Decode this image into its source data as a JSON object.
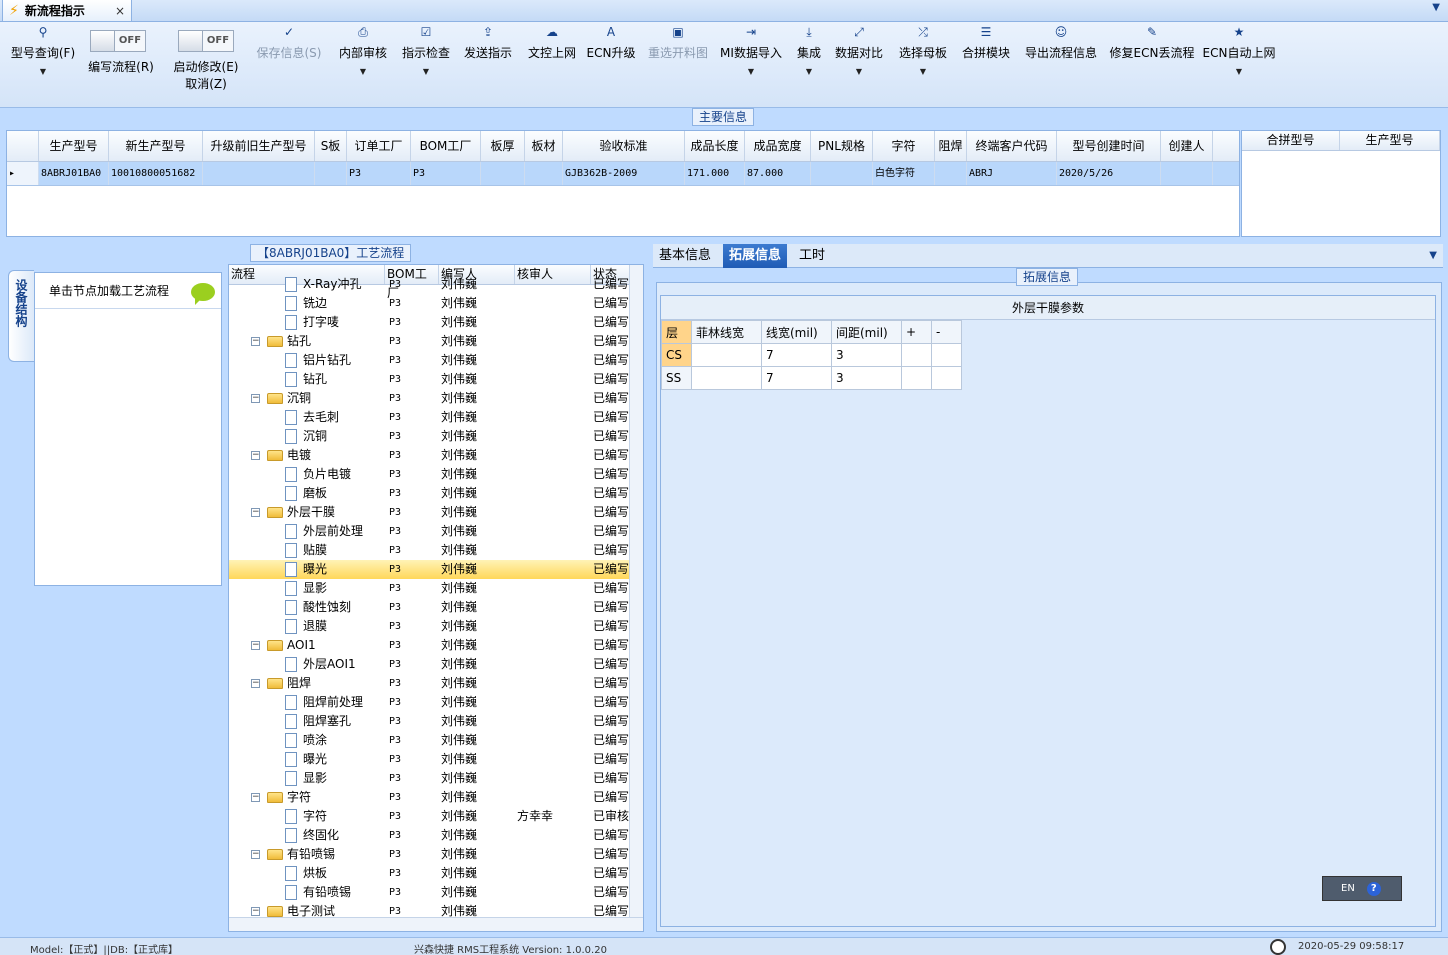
{
  "window": {
    "tab_title": "新流程指示",
    "close": "×",
    "menu_arrow": "▼"
  },
  "ribbon": {
    "buttons": [
      {
        "id": "query",
        "label": "型号查询(F)",
        "icon": "search-icon",
        "glyph": "⚲",
        "dropdown": true,
        "disabled": false
      },
      {
        "id": "save",
        "label": "保存信息(S)",
        "icon": "check-icon",
        "glyph": "✓",
        "dropdown": false,
        "disabled": true
      },
      {
        "id": "review",
        "label": "内部审核",
        "icon": "print-icon",
        "glyph": "⎙",
        "dropdown": true,
        "disabled": false
      },
      {
        "id": "check",
        "label": "指示检查",
        "icon": "checkbox-icon",
        "glyph": "☑",
        "dropdown": true,
        "disabled": false
      },
      {
        "id": "send",
        "label": "发送指示",
        "icon": "upload-icon",
        "glyph": "⇪",
        "dropdown": false,
        "disabled": false
      },
      {
        "id": "control",
        "label": "文控上网",
        "icon": "cloud-icon",
        "glyph": "☁",
        "dropdown": false,
        "disabled": false
      },
      {
        "id": "ecn",
        "label": "ECN升级",
        "icon": "tool-icon",
        "glyph": "A",
        "dropdown": false,
        "disabled": false
      },
      {
        "id": "reselect",
        "label": "重选开料图",
        "icon": "image-icon",
        "glyph": "▣",
        "dropdown": false,
        "disabled": true
      },
      {
        "id": "mi",
        "label": "MI数据导入",
        "icon": "import-icon",
        "glyph": "⇥",
        "dropdown": true,
        "disabled": false
      },
      {
        "id": "integrate",
        "label": "集成",
        "icon": "download-icon",
        "glyph": "⤓",
        "dropdown": true,
        "disabled": false
      },
      {
        "id": "compare",
        "label": "数据对比",
        "icon": "compare-icon",
        "glyph": "⤢",
        "dropdown": true,
        "disabled": false
      },
      {
        "id": "mother",
        "label": "选择母板",
        "icon": "shuffle-icon",
        "glyph": "⤮",
        "dropdown": true,
        "disabled": false
      },
      {
        "id": "merge",
        "label": "合拼模块",
        "icon": "list-icon",
        "glyph": "☰",
        "dropdown": false,
        "disabled": false
      },
      {
        "id": "export",
        "label": "导出流程信息",
        "icon": "smile-icon",
        "glyph": "☺",
        "dropdown": false,
        "disabled": false
      },
      {
        "id": "repair",
        "label": "修复ECN丢流程",
        "icon": "wrench-icon",
        "glyph": "✎",
        "dropdown": false,
        "disabled": false
      },
      {
        "id": "auto",
        "label": "ECN自动上网",
        "icon": "star-icon",
        "glyph": "★",
        "dropdown": true,
        "disabled": false
      }
    ],
    "toggle_edit": {
      "state": "OFF",
      "label": "编写流程(R)"
    },
    "toggle_start": {
      "state": "OFF",
      "label": "启动修改(E)",
      "sub_label": "取消(Z)"
    }
  },
  "main_info": {
    "caption": "主要信息",
    "columns": [
      "生产型号",
      "新生产型号",
      "升级前旧生产型号",
      "S板",
      "订单工厂",
      "BOM工厂",
      "板厚",
      "板材",
      "验收标准",
      "成品长度",
      "成品宽度",
      "PNL规格",
      "字符",
      "阻焊",
      "终端客户代码",
      "型号创建时间",
      "创建人"
    ],
    "row": [
      "8ABRJ01BA0",
      "10010800051682",
      "",
      "",
      "P3",
      "P3",
      "",
      "",
      "GJB362B-2009",
      "171.000",
      "87.000",
      "",
      "白色字符",
      "",
      "ABRJ",
      "2020/5/26",
      ""
    ]
  },
  "combine": {
    "columns": [
      "合拼型号",
      "生产型号"
    ]
  },
  "side_tab": "设备结构",
  "node_panel": {
    "hint": "单击节点加载工艺流程"
  },
  "tree": {
    "caption": "【8ABRJ01BA0】工艺流程",
    "columns": [
      "流程",
      "BOM工厂",
      "编写人",
      "核审人",
      "状态"
    ],
    "rows": [
      {
        "level": 1,
        "name": "X-Ray冲孔",
        "bom": "P3",
        "writer": "刘伟巍",
        "reviewer": "",
        "status": "已编写"
      },
      {
        "level": 1,
        "name": "铣边",
        "bom": "P3",
        "writer": "刘伟巍",
        "reviewer": "",
        "status": "已编写"
      },
      {
        "level": 1,
        "name": "打字唛",
        "bom": "P3",
        "writer": "刘伟巍",
        "reviewer": "",
        "status": "已编写"
      },
      {
        "level": 0,
        "name": "钻孔",
        "bom": "P3",
        "writer": "刘伟巍",
        "reviewer": "",
        "status": "已编写"
      },
      {
        "level": 1,
        "name": "铝片钻孔",
        "bom": "P3",
        "writer": "刘伟巍",
        "reviewer": "",
        "status": "已编写"
      },
      {
        "level": 1,
        "name": "钻孔",
        "bom": "P3",
        "writer": "刘伟巍",
        "reviewer": "",
        "status": "已编写"
      },
      {
        "level": 0,
        "name": "沉铜",
        "bom": "P3",
        "writer": "刘伟巍",
        "reviewer": "",
        "status": "已编写"
      },
      {
        "level": 1,
        "name": "去毛刺",
        "bom": "P3",
        "writer": "刘伟巍",
        "reviewer": "",
        "status": "已编写"
      },
      {
        "level": 1,
        "name": "沉铜",
        "bom": "P3",
        "writer": "刘伟巍",
        "reviewer": "",
        "status": "已编写"
      },
      {
        "level": 0,
        "name": "电镀",
        "bom": "P3",
        "writer": "刘伟巍",
        "reviewer": "",
        "status": "已编写"
      },
      {
        "level": 1,
        "name": "负片电镀",
        "bom": "P3",
        "writer": "刘伟巍",
        "reviewer": "",
        "status": "已编写"
      },
      {
        "level": 1,
        "name": "磨板",
        "bom": "P3",
        "writer": "刘伟巍",
        "reviewer": "",
        "status": "已编写"
      },
      {
        "level": 0,
        "name": "外层干膜",
        "bom": "P3",
        "writer": "刘伟巍",
        "reviewer": "",
        "status": "已编写"
      },
      {
        "level": 1,
        "name": "外层前处理",
        "bom": "P3",
        "writer": "刘伟巍",
        "reviewer": "",
        "status": "已编写"
      },
      {
        "level": 1,
        "name": "贴膜",
        "bom": "P3",
        "writer": "刘伟巍",
        "reviewer": "",
        "status": "已编写"
      },
      {
        "level": 1,
        "name": "曝光",
        "bom": "P3",
        "writer": "刘伟巍",
        "reviewer": "",
        "status": "已编写",
        "selected": true
      },
      {
        "level": 1,
        "name": "显影",
        "bom": "P3",
        "writer": "刘伟巍",
        "reviewer": "",
        "status": "已编写"
      },
      {
        "level": 1,
        "name": "酸性蚀刻",
        "bom": "P3",
        "writer": "刘伟巍",
        "reviewer": "",
        "status": "已编写"
      },
      {
        "level": 1,
        "name": "退膜",
        "bom": "P3",
        "writer": "刘伟巍",
        "reviewer": "",
        "status": "已编写"
      },
      {
        "level": 0,
        "name": "AOI1",
        "bom": "P3",
        "writer": "刘伟巍",
        "reviewer": "",
        "status": "已编写"
      },
      {
        "level": 1,
        "name": "外层AOI1",
        "bom": "P3",
        "writer": "刘伟巍",
        "reviewer": "",
        "status": "已编写"
      },
      {
        "level": 0,
        "name": "阻焊",
        "bom": "P3",
        "writer": "刘伟巍",
        "reviewer": "",
        "status": "已编写"
      },
      {
        "level": 1,
        "name": "阻焊前处理",
        "bom": "P3",
        "writer": "刘伟巍",
        "reviewer": "",
        "status": "已编写"
      },
      {
        "level": 1,
        "name": "阻焊塞孔",
        "bom": "P3",
        "writer": "刘伟巍",
        "reviewer": "",
        "status": "已编写"
      },
      {
        "level": 1,
        "name": "喷涂",
        "bom": "P3",
        "writer": "刘伟巍",
        "reviewer": "",
        "status": "已编写"
      },
      {
        "level": 1,
        "name": "曝光",
        "bom": "P3",
        "writer": "刘伟巍",
        "reviewer": "",
        "status": "已编写"
      },
      {
        "level": 1,
        "name": "显影",
        "bom": "P3",
        "writer": "刘伟巍",
        "reviewer": "",
        "status": "已编写"
      },
      {
        "level": 0,
        "name": "字符",
        "bom": "P3",
        "writer": "刘伟巍",
        "reviewer": "",
        "status": "已编写"
      },
      {
        "level": 1,
        "name": "字符",
        "bom": "P3",
        "writer": "刘伟巍",
        "reviewer": "方幸幸",
        "status": "已审核"
      },
      {
        "level": 1,
        "name": "终固化",
        "bom": "P3",
        "writer": "刘伟巍",
        "reviewer": "",
        "status": "已编写"
      },
      {
        "level": 0,
        "name": "有铅喷锡",
        "bom": "P3",
        "writer": "刘伟巍",
        "reviewer": "",
        "status": "已编写"
      },
      {
        "level": 1,
        "name": "烘板",
        "bom": "P3",
        "writer": "刘伟巍",
        "reviewer": "",
        "status": "已编写"
      },
      {
        "level": 1,
        "name": "有铅喷锡",
        "bom": "P3",
        "writer": "刘伟巍",
        "reviewer": "",
        "status": "已编写"
      },
      {
        "level": 0,
        "name": "电子测试",
        "bom": "P3",
        "writer": "刘伟巍",
        "reviewer": "",
        "status": "已编写"
      }
    ]
  },
  "right": {
    "tabs": [
      "基本信息",
      "拓展信息",
      "工时"
    ],
    "active_tab": 1,
    "ext_caption": "拓展信息",
    "film_title": "外层干膜参数",
    "film_columns": [
      "层",
      "菲林线宽",
      "线宽(mil)",
      "间距(mil)",
      "+",
      "-"
    ],
    "film_rows": [
      [
        "CS",
        "",
        "7",
        "3",
        "",
        ""
      ],
      [
        "SS",
        "",
        "7",
        "3",
        "",
        ""
      ]
    ]
  },
  "lang": {
    "code": "EN",
    "help": "?"
  },
  "status": {
    "left": "Model:【正式】||DB:【正式库】",
    "center": "兴森快捷 RMS工程系统 Version: 1.0.0.20",
    "time": "2020-05-29 09:58:17"
  }
}
